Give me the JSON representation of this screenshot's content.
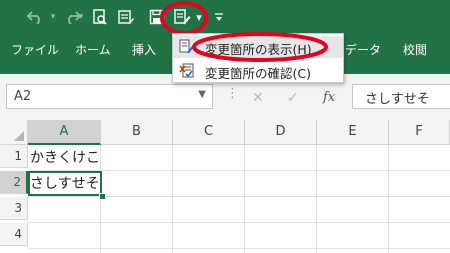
{
  "quick_access": {
    "undo_icon": "undo-icon",
    "redo_icon": "redo-icon",
    "print_preview_icon": "print-preview-icon",
    "form_icon": "form-icon",
    "save_icon": "save-icon",
    "track_changes_icon": "track-changes-icon",
    "dropdown_caret": "▾",
    "customize_caret": "▾"
  },
  "ribbon_tabs": [
    {
      "label": "ファイル"
    },
    {
      "label": "ホーム"
    },
    {
      "label": "挿入"
    },
    {
      "label": "データ"
    },
    {
      "label": "校閲"
    }
  ],
  "track_changes_menu": {
    "items": [
      {
        "label": "変更箇所の表示(H)...",
        "icon": "highlight-changes-icon"
      },
      {
        "label": "変更箇所の確認(C)",
        "icon": "accept-reject-icon"
      }
    ]
  },
  "formula_bar": {
    "name_box": "A2",
    "cancel": "✕",
    "enter": "✓",
    "fx": "fx",
    "value": "さしすせそ"
  },
  "sheet": {
    "columns": [
      "A",
      "B",
      "C",
      "D",
      "E",
      "F"
    ],
    "rows": [
      "1",
      "2",
      "3",
      "4"
    ],
    "cells": {
      "A1": "かきくけこ",
      "A2": "さしすせそ"
    },
    "selected_cell": "A2"
  },
  "colors": {
    "ribbon": "#217346",
    "highlight_circle": "#e8001c"
  }
}
